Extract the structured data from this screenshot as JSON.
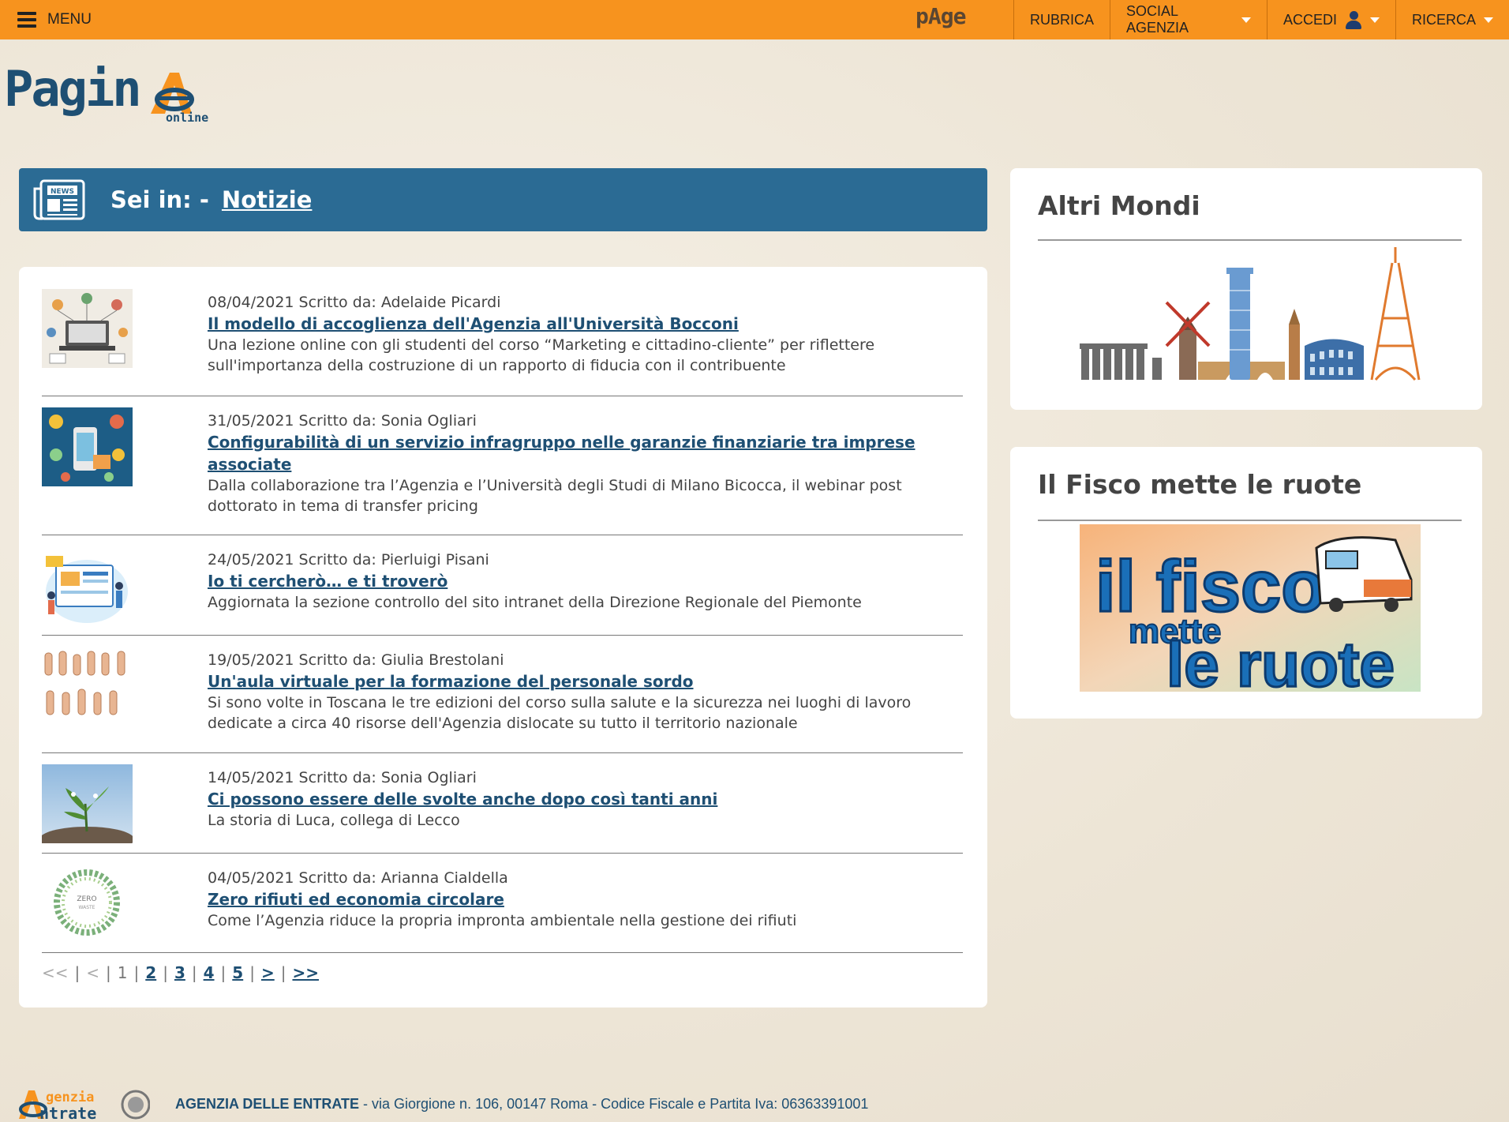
{
  "topbar": {
    "menu_label": "MENU",
    "brand": "pAge",
    "nav": [
      {
        "label": "RUBRICA",
        "caret": false
      },
      {
        "label": "SOCIAL AGENZIA",
        "caret": true
      },
      {
        "label": "ACCEDI",
        "caret": true,
        "user_icon": true
      },
      {
        "label": "RICERCA",
        "caret": true
      }
    ]
  },
  "logo": {
    "text": "Pagin",
    "sub": "online"
  },
  "breadcrumb": {
    "prefix": "Sei in: -",
    "current": "Notizie"
  },
  "news": [
    {
      "meta": "08/04/2021 Scritto da: Adelaide Picardi",
      "title": "Il modello di accoglienza dell'Agenzia all'Università Bocconi",
      "desc": "Una lezione online con gli studenti del corso “Marketing e cittadino-cliente” per riflettere sull'importanza della costruzione di un rapporto di fiducia con il contribuente",
      "thumb": "laptop-network-illustration"
    },
    {
      "meta": "31/05/2021 Scritto da: Sonia Ogliari",
      "title": "Configurabilità di un servizio infragruppo nelle garanzie finanziarie tra imprese associate",
      "desc": "Dalla collaborazione tra l’Agenzia e l’Università degli Studi di Milano Bicocca, il webinar post dottorato in tema di transfer pricing",
      "thumb": "finance-icons-illustration"
    },
    {
      "meta": "24/05/2021 Scritto da: Pierluigi Pisani",
      "title": "Io ti cercherò… e ti troverò",
      "desc": "Aggiornata la sezione controllo del sito intranet della Direzione Regionale del Piemonte",
      "thumb": "website-people-illustration"
    },
    {
      "meta": "19/05/2021 Scritto da: Giulia Brestolani",
      "title": "Un'aula virtuale per la formazione del personale sordo",
      "desc": "Si sono volte in Toscana le tre edizioni del corso sulla salute e la sicurezza nei luoghi di lavoro dedicate a circa 40 risorse dell'Agenzia dislocate su tutto il territorio nazionale",
      "thumb": "sign-language-hands"
    },
    {
      "meta": "14/05/2021 Scritto da: Sonia Ogliari",
      "title": "Ci possono essere delle svolte anche dopo così tanti anni",
      "desc": "La storia di Luca, collega di Lecco",
      "thumb": "plant-sprout-photo"
    },
    {
      "meta": "04/05/2021 Scritto da: Arianna Cialdella",
      "title": "Zero rifiuti ed economia circolare",
      "desc": "Come l’Agenzia riduce la propria impronta ambientale nella gestione dei rifiuti",
      "thumb": "zero-waste-wreath"
    }
  ],
  "pager": {
    "first": "<<",
    "prev": "<",
    "current": "1",
    "pages": [
      "2",
      "3",
      "4",
      "5"
    ],
    "next": ">",
    "last": ">>",
    "sep": "|"
  },
  "widgets": {
    "altri_mondi": {
      "title": "Altri Mondi"
    },
    "fisco": {
      "title": "Il Fisco mette le ruote",
      "banner_line1": "il fisco",
      "banner_line2": "mette",
      "banner_line3": "le ruote"
    }
  },
  "footer": {
    "logo_text_top": "genzia",
    "logo_text_bottom": "ntrate",
    "org": "AGENZIA DELLE ENTRATE",
    "address": " - via Giorgione n. 106, 00147 Roma - Codice Fiscale e Partita Iva: 06363391001"
  },
  "colors": {
    "topbar": "#f7931e",
    "breadcrumb": "#2b6b94",
    "link": "#1e4f73",
    "background": "#f1ebdf"
  }
}
